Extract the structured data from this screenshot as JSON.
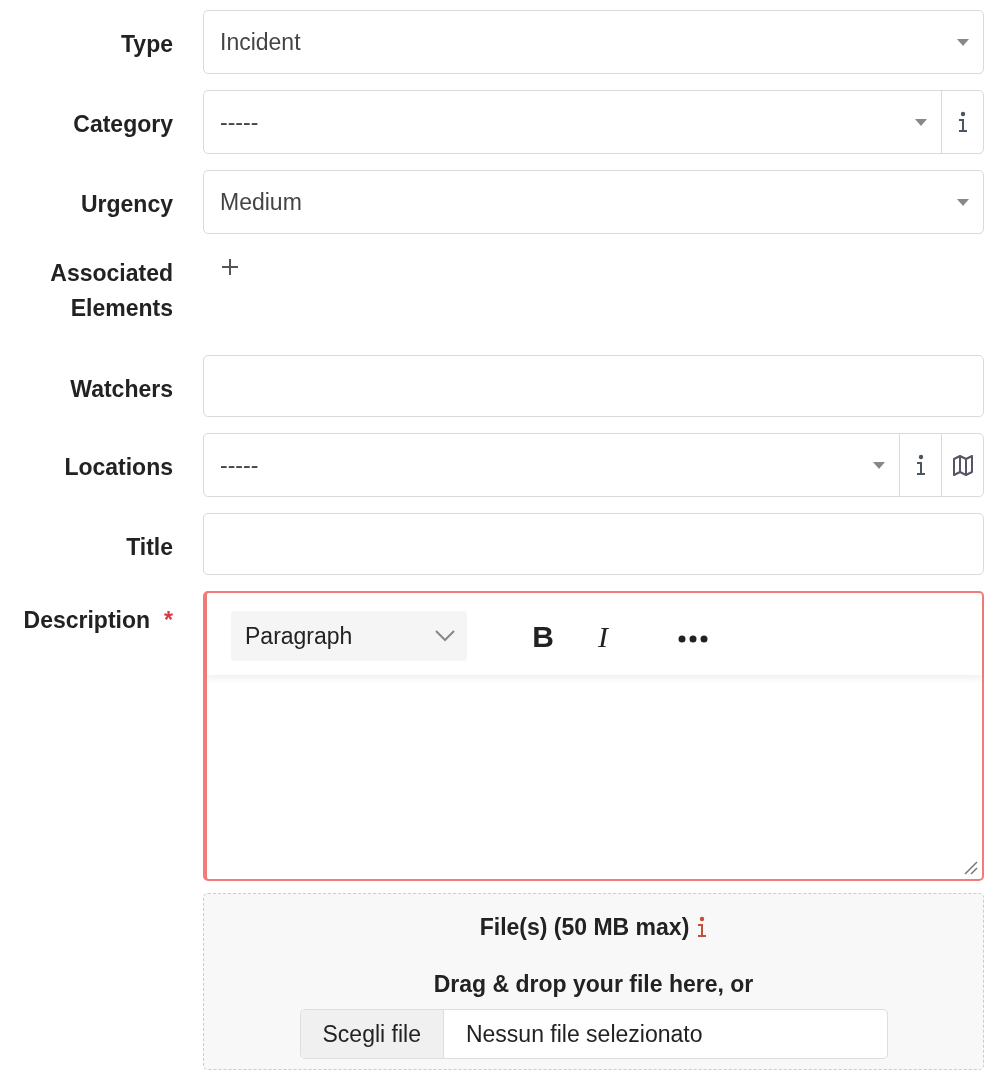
{
  "fields": [
    {
      "kind": "select",
      "label": "Type",
      "value": "Incident"
    },
    {
      "kind": "select",
      "label": "Category",
      "value": "-----",
      "info_button": true
    },
    {
      "kind": "select",
      "label": "Urgency",
      "value": "Medium"
    },
    {
      "kind": "add",
      "label": "Associated Elements"
    },
    {
      "kind": "text",
      "label": "Watchers"
    },
    {
      "kind": "select",
      "label": "Locations",
      "value": "-----",
      "info_button": true,
      "map_button": true
    },
    {
      "kind": "text",
      "label": "Title"
    },
    {
      "kind": "editor",
      "label": "Description",
      "required_mark": "*",
      "invalid": true,
      "block_format": "Paragraph",
      "bold": "B",
      "italic": "I"
    }
  ],
  "attachments": {
    "title": "File(s) (50 MB max)",
    "hint": "Drag & drop your file here, or",
    "choose_button": "Scegli file",
    "file_status": "Nessun file selezionato"
  }
}
